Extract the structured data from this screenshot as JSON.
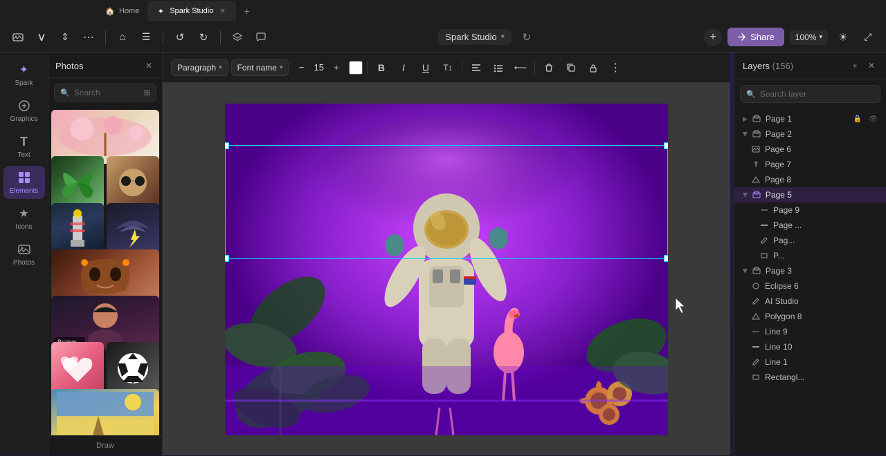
{
  "browser": {
    "tabs": [
      {
        "id": "home",
        "label": "Home",
        "icon": "🏠",
        "active": false
      },
      {
        "id": "spark-studio",
        "label": "Spark Studio",
        "icon": "✦",
        "active": true
      }
    ],
    "tab_add_label": "+"
  },
  "header": {
    "icons": [
      {
        "id": "image-ico",
        "symbol": "🖼",
        "label": "Image"
      },
      {
        "id": "bold-ico",
        "symbol": "V",
        "label": "Bold"
      },
      {
        "id": "italic-ico",
        "symbol": "⇕",
        "label": "Italic"
      },
      {
        "id": "more-ico",
        "symbol": "⋯",
        "label": "More"
      },
      {
        "id": "home-ico",
        "symbol": "⌂",
        "label": "Home"
      },
      {
        "id": "align-ico",
        "symbol": "☰",
        "label": "Align"
      },
      {
        "id": "undo-ico",
        "symbol": "↺",
        "label": "Undo"
      },
      {
        "id": "redo-ico",
        "symbol": "↻",
        "label": "Redo"
      },
      {
        "id": "layers-ico",
        "symbol": "⊞",
        "label": "Layers"
      },
      {
        "id": "comment-ico",
        "symbol": "💬",
        "label": "Comment"
      }
    ],
    "project_name": "Spark Studio",
    "add_btn": "+",
    "share_btn": "Share",
    "zoom": "100%"
  },
  "sidebar": {
    "items": [
      {
        "id": "spark",
        "icon": "✦",
        "label": "Spark",
        "active": false
      },
      {
        "id": "graphics",
        "icon": "◈",
        "label": "Graphics",
        "active": false
      },
      {
        "id": "text",
        "icon": "T",
        "label": "Text",
        "active": false
      },
      {
        "id": "elements",
        "icon": "⬡",
        "label": "Elements",
        "active": true
      },
      {
        "id": "icons",
        "icon": "★",
        "label": "Icons",
        "active": false
      },
      {
        "id": "photos",
        "icon": "🖼",
        "label": "Photos",
        "active": false
      }
    ]
  },
  "photos_panel": {
    "title": "Photos",
    "search_placeholder": "Search",
    "photos": [
      {
        "id": "cherry",
        "style": "ph-cherry",
        "wide": true
      },
      {
        "id": "butterfly",
        "style": "ph-butterfly",
        "wide": false
      },
      {
        "id": "sunglasses",
        "style": "ph-sunglasses",
        "wide": false
      },
      {
        "id": "lighthouse",
        "style": "ph-lighthouse",
        "wide": false
      },
      {
        "id": "storm",
        "style": "ph-storm",
        "wide": false
      },
      {
        "id": "mask",
        "style": "ph-mask",
        "wide": true
      },
      {
        "id": "girl",
        "style": "ph-girl",
        "wide": true
      },
      {
        "id": "hearts",
        "style": "ph-hearts",
        "wide": false
      },
      {
        "id": "soccer",
        "style": "ph-soccer",
        "wide": false
      },
      {
        "id": "beach",
        "style": "ph-beach",
        "wide": true
      }
    ],
    "labels": {
      "brainwave": "Brainw...",
      "draw": "Draw"
    }
  },
  "toolbar": {
    "paragraph_label": "Paragraph",
    "font_name_label": "Font name",
    "decrease_size": "−",
    "font_size": "15",
    "increase_size": "+",
    "buttons": [
      "B",
      "I",
      "U",
      "T↕",
      "≡",
      "≣",
      "⟵",
      "🗑",
      "⊟",
      "🔒",
      "⋮"
    ],
    "button_names": [
      "bold",
      "italic",
      "underline",
      "text-style",
      "align-left",
      "align-list",
      "indent",
      "delete",
      "duplicate",
      "lock",
      "more"
    ]
  },
  "layers": {
    "title": "Layers",
    "count": "156",
    "search_placeholder": "Search layer",
    "items": [
      {
        "id": "page1",
        "label": "Page 1",
        "type": "group",
        "indent": 0,
        "expanded": false,
        "locked": true
      },
      {
        "id": "page2",
        "label": "Page 2",
        "type": "group",
        "indent": 0,
        "expanded": true
      },
      {
        "id": "page6",
        "label": "Page 6",
        "type": "image",
        "indent": 1
      },
      {
        "id": "page7",
        "label": "Page 7",
        "type": "text",
        "indent": 1
      },
      {
        "id": "page8",
        "label": "Page 8",
        "type": "triangle",
        "indent": 1
      },
      {
        "id": "page5",
        "label": "Page 5",
        "type": "group",
        "indent": 0,
        "expanded": true,
        "active": true
      },
      {
        "id": "page9",
        "label": "Page 9",
        "type": "line-thin",
        "indent": 2
      },
      {
        "id": "page-dash",
        "label": "Page ...",
        "type": "line-thick",
        "indent": 2
      },
      {
        "id": "page-pen",
        "label": "Pag...",
        "type": "pen",
        "indent": 2
      },
      {
        "id": "page-rect",
        "label": "P...",
        "type": "rect",
        "indent": 2
      },
      {
        "id": "page3",
        "label": "Page 3",
        "type": "group",
        "indent": 0,
        "expanded": true
      },
      {
        "id": "eclipse6",
        "label": "Eclipse 6",
        "type": "circle",
        "indent": 1
      },
      {
        "id": "ai-studio",
        "label": "AI Studio",
        "type": "pen",
        "indent": 1
      },
      {
        "id": "polygon8",
        "label": "Polygon 8",
        "type": "triangle",
        "indent": 1
      },
      {
        "id": "line9",
        "label": "Line 9",
        "type": "line-thin",
        "indent": 1
      },
      {
        "id": "line10",
        "label": "Line 10",
        "type": "line-thick",
        "indent": 1
      },
      {
        "id": "line1",
        "label": "Line 1",
        "type": "pen",
        "indent": 1
      },
      {
        "id": "rectangl",
        "label": "Rectangl...",
        "type": "rect",
        "indent": 1
      }
    ]
  },
  "canvas": {
    "background": "purple"
  }
}
